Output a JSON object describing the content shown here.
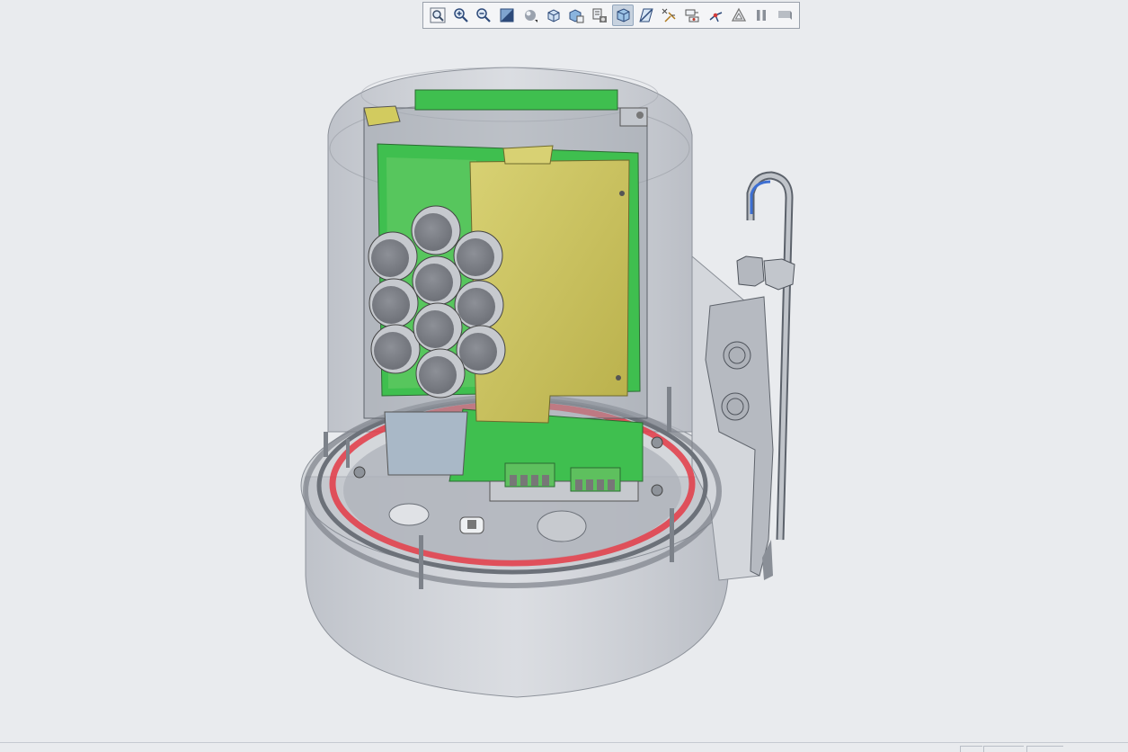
{
  "toolbar": {
    "buttons": [
      {
        "name": "refit-view-button",
        "icon": "magnifier-frame-icon"
      },
      {
        "name": "zoom-in-button",
        "icon": "zoom-in-icon"
      },
      {
        "name": "zoom-out-button",
        "icon": "zoom-out-icon"
      },
      {
        "name": "repaint-button",
        "icon": "repaint-icon"
      },
      {
        "name": "display-style-button",
        "icon": "shading-sphere-icon"
      },
      {
        "name": "saved-orientations-button",
        "icon": "cube-orientation-icon"
      },
      {
        "name": "view-manager-button",
        "icon": "view-manager-icon"
      },
      {
        "name": "section-button",
        "icon": "section-icon"
      },
      {
        "name": "perspective-button",
        "icon": "perspective-cube-icon",
        "active": true
      },
      {
        "name": "datum-planes-button",
        "icon": "datum-plane-icon"
      },
      {
        "name": "datum-points-button",
        "icon": "datum-point-icon"
      },
      {
        "name": "annotation-display-button",
        "icon": "annotation-icon"
      },
      {
        "name": "spin-center-button",
        "icon": "spin-center-icon"
      },
      {
        "name": "simplified-rep-button",
        "icon": "triangle-rep-icon"
      },
      {
        "name": "pause-regen-button",
        "icon": "pause-icon"
      },
      {
        "name": "next-step-button",
        "icon": "flag-icon"
      }
    ]
  },
  "colors": {
    "background": "#e9ebee",
    "housing": "#b8bcc4",
    "pcb": "#3fbf4f",
    "panel": "#c9c25a",
    "seal": "#e33a45",
    "capacitor": "#8a8d94",
    "active_button": "#c7d2df"
  }
}
